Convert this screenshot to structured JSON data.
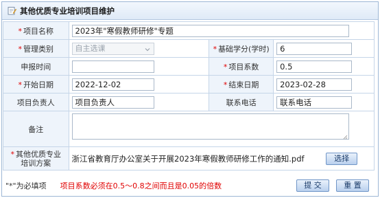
{
  "header": {
    "title": "其他优质专业培训项目维护",
    "icon": "edit-note-icon"
  },
  "required_mark": "*",
  "fields": {
    "project_name": {
      "label": "项目名称",
      "value": "2023年\"寒假教师研修\"专题"
    },
    "category": {
      "label": "管理类别",
      "value": "自主选课"
    },
    "base_credit": {
      "label": "基础学分(学时)",
      "value": "6"
    },
    "apply_time": {
      "label": "申报时间",
      "value": ""
    },
    "coefficient": {
      "label": "项目系数",
      "value": "0.5"
    },
    "start_date": {
      "label": "开始日期",
      "value": "2022-12-02"
    },
    "end_date": {
      "label": "结束日期",
      "value": "2023-02-28"
    },
    "leader": {
      "label": "项目负责人",
      "value": "项目负责人"
    },
    "phone": {
      "label": "联系电话",
      "value": "联系电话"
    },
    "remark": {
      "label": "备注",
      "value": ""
    },
    "plan": {
      "label_line1": "其他优质专业",
      "label_line2": "培训方案",
      "file": "浙江省教育厅办公室关于开展2023年寒假教师研修工作的通知.pdf",
      "choose_label": "选择"
    }
  },
  "footer": {
    "legend": "\"*\"为必填项",
    "hint": "项目系数必须在0.5～0.8之间而且是0.05的倍数",
    "submit_label": "提 交",
    "reset_label": "重 置"
  },
  "colors": {
    "required": "#e00000",
    "border": "#c5d5e8",
    "label_bg": "#eef4fb"
  }
}
